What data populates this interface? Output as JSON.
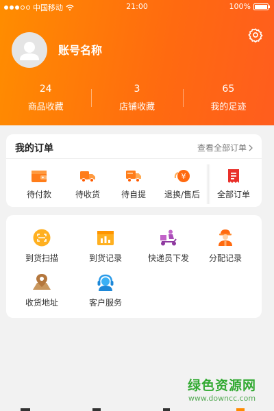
{
  "status_bar": {
    "carrier": "中国移动",
    "time": "21:00",
    "battery": "100%",
    "signal_level": 3
  },
  "profile": {
    "account_name": "账号名称"
  },
  "stats": [
    {
      "count": "24",
      "label": "商品收藏"
    },
    {
      "count": "3",
      "label": "店铺收藏"
    },
    {
      "count": "65",
      "label": "我的足迹"
    }
  ],
  "orders": {
    "title": "我的订单",
    "view_all": "查看全部订单",
    "items": [
      {
        "label": "待付款",
        "icon": "wallet-icon"
      },
      {
        "label": "待收货",
        "icon": "truck-icon"
      },
      {
        "label": "待自提",
        "icon": "pickup-truck-icon"
      },
      {
        "label": "退换/售后",
        "icon": "yen-refund-icon"
      },
      {
        "label": "全部订单",
        "icon": "receipt-icon"
      }
    ]
  },
  "services": [
    {
      "label": "到货扫描",
      "icon": "scan-icon"
    },
    {
      "label": "到货记录",
      "icon": "record-chart-icon"
    },
    {
      "label": "快递员下发",
      "icon": "courier-scooter-icon"
    },
    {
      "label": "分配记录",
      "icon": "worker-icon"
    },
    {
      "label": "收货地址",
      "icon": "map-pin-icon"
    },
    {
      "label": "客户服务",
      "icon": "headset-icon"
    }
  ],
  "watermark": {
    "main": "绿色资源网",
    "sub": "www.downcc.com"
  },
  "colors": {
    "header": "#ff7300",
    "accent": "#ff6a10",
    "watermark": "#33aa33"
  }
}
